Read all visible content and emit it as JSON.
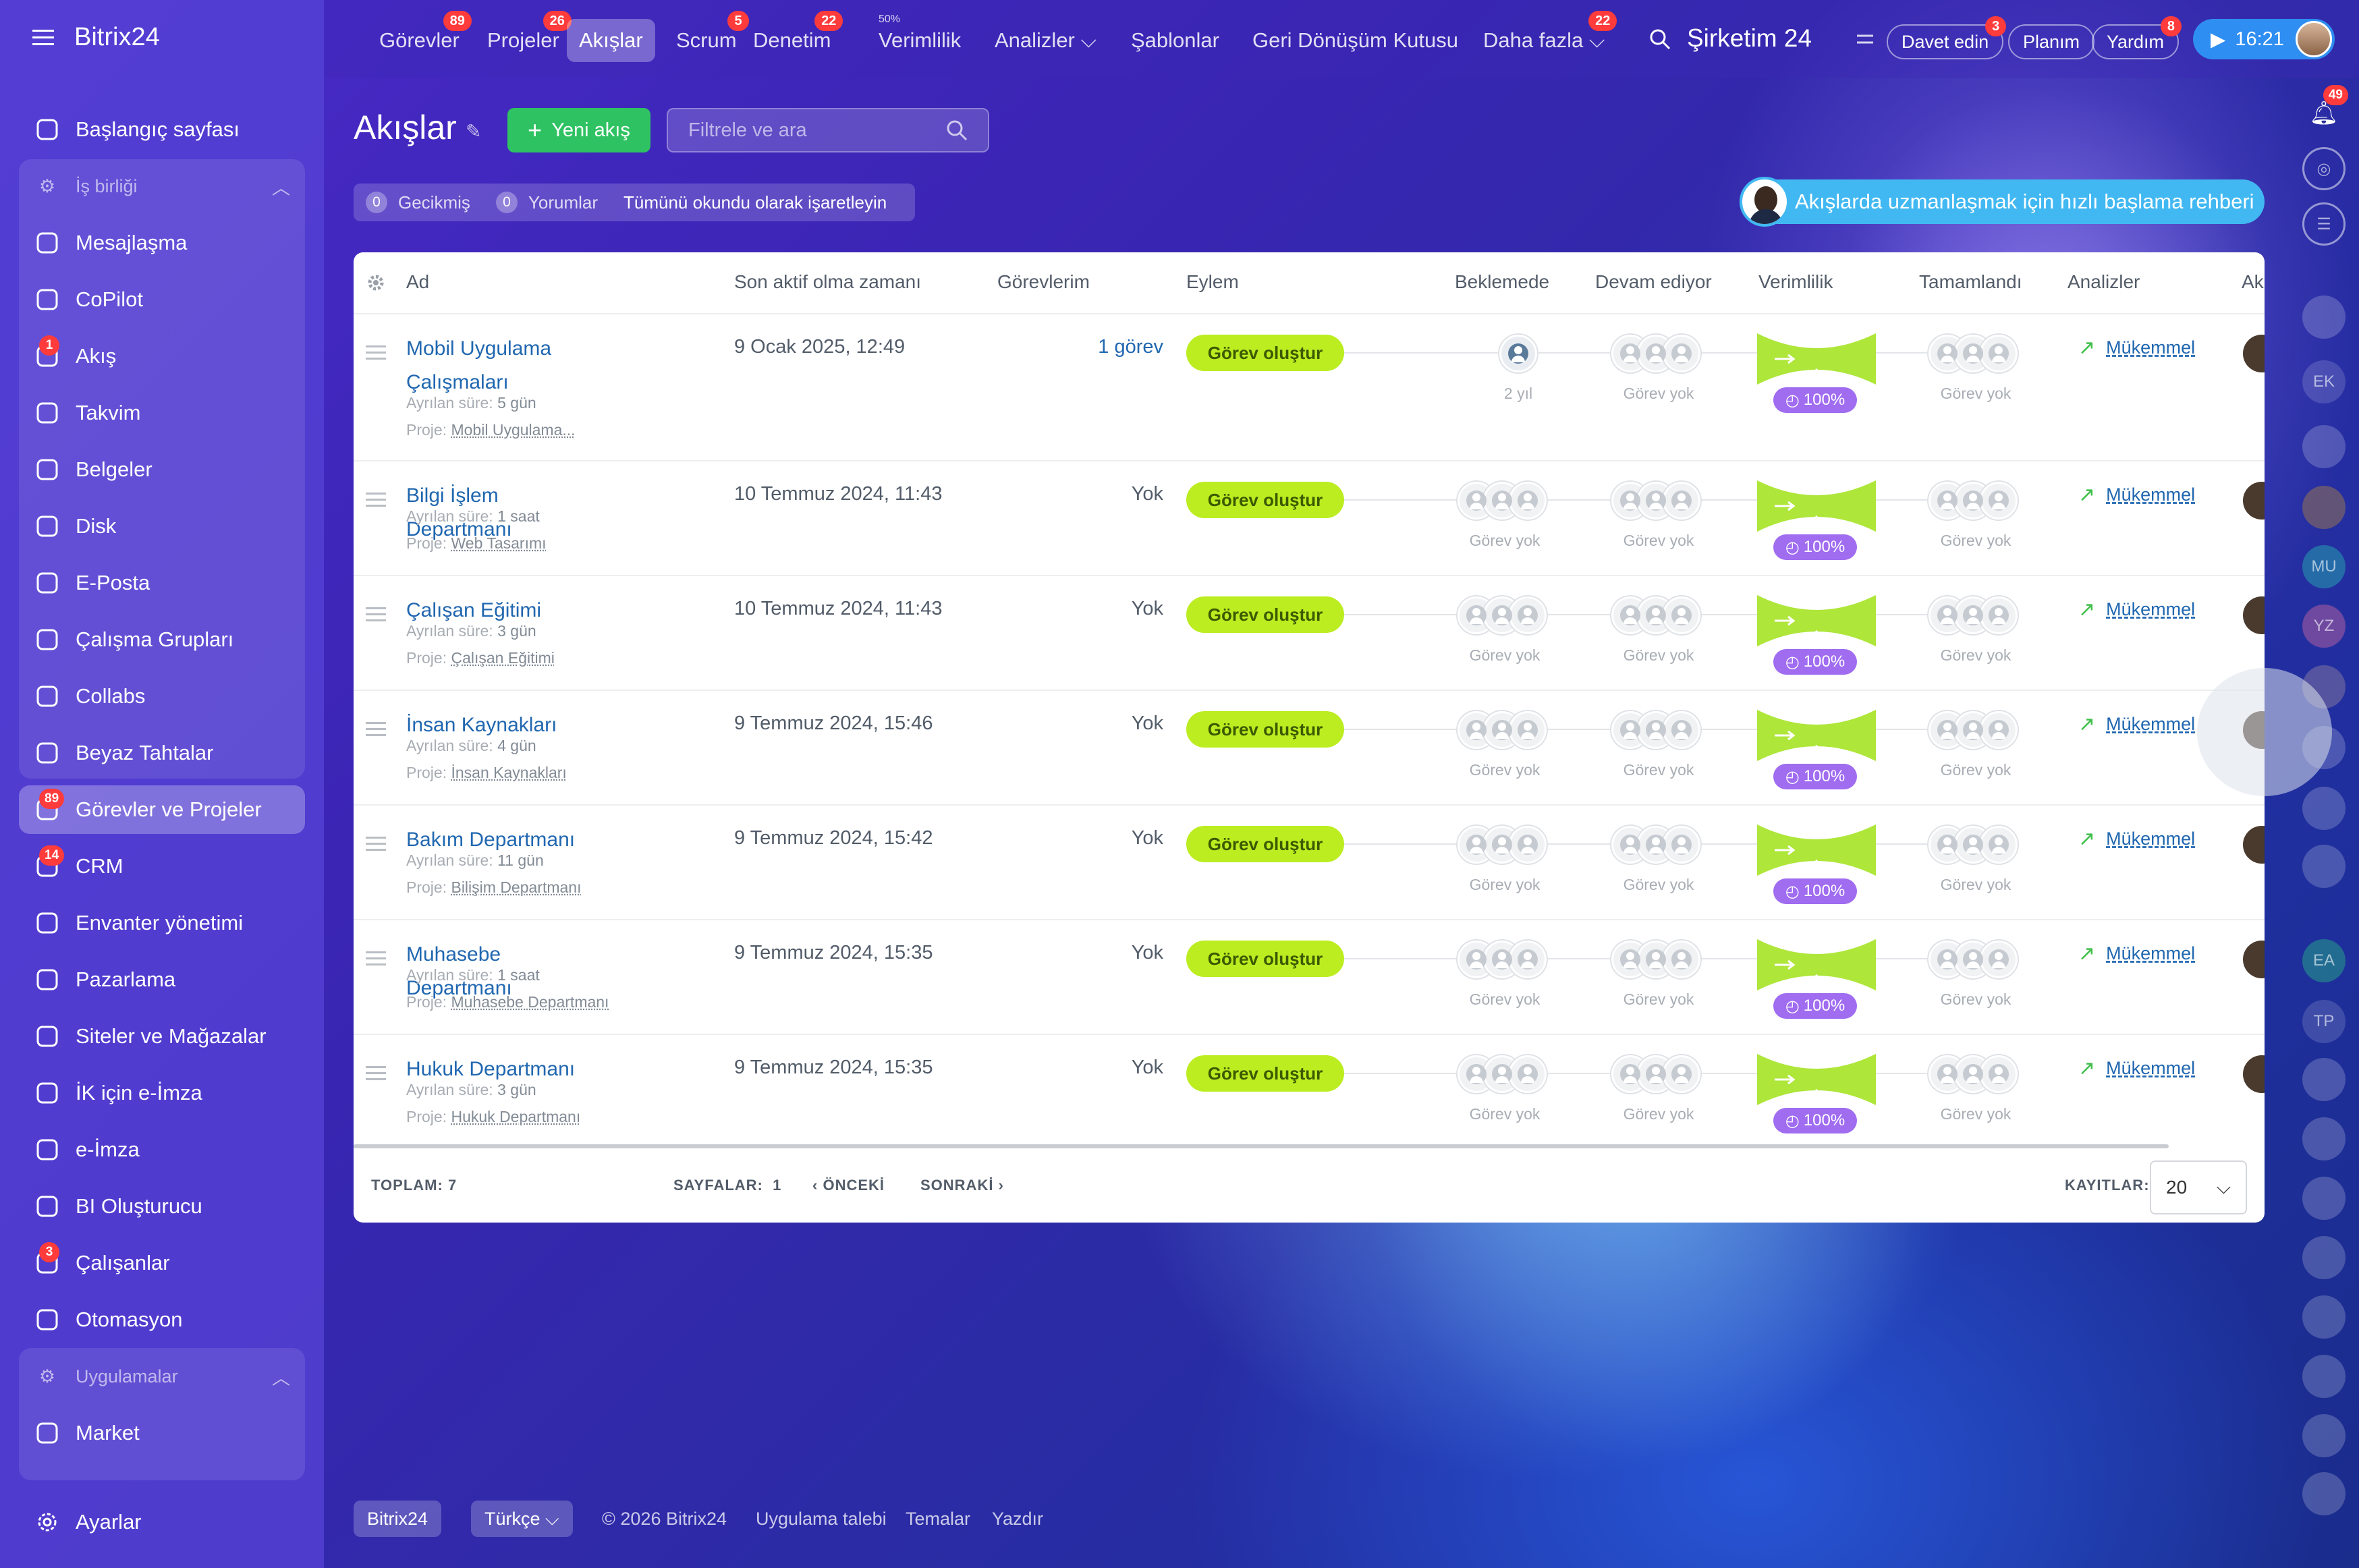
{
  "app": {
    "brand": "Bitrix24"
  },
  "sidebar": {
    "items": [
      {
        "label": "Başlangıç sayfası",
        "icon": "home-icon"
      },
      {
        "label": "Mesajlaşma",
        "icon": "chat-icon"
      },
      {
        "label": "CoPilot",
        "icon": "copilot-icon"
      },
      {
        "label": "Akış",
        "icon": "feed-icon",
        "badge": "1"
      },
      {
        "label": "Takvim",
        "icon": "calendar-icon"
      },
      {
        "label": "Belgeler",
        "icon": "document-icon"
      },
      {
        "label": "Disk",
        "icon": "disk-icon"
      },
      {
        "label": "E-Posta",
        "icon": "mail-icon"
      },
      {
        "label": "Çalışma Grupları",
        "icon": "group-icon"
      },
      {
        "label": "Collabs",
        "icon": "collabs-icon"
      },
      {
        "label": "Beyaz Tahtalar",
        "icon": "whiteboard-icon"
      },
      {
        "label": "Görevler ve Projeler",
        "icon": "tasks-icon",
        "badge": "89"
      },
      {
        "label": "CRM",
        "icon": "crm-icon",
        "badge": "14"
      },
      {
        "label": "Envanter yönetimi",
        "icon": "inventory-icon"
      },
      {
        "label": "Pazarlama",
        "icon": "marketing-icon"
      },
      {
        "label": "Siteler ve Mağazalar",
        "icon": "cart-icon"
      },
      {
        "label": "İK için e-İmza",
        "icon": "hr-sign-icon"
      },
      {
        "label": "e-İmza",
        "icon": "sign-icon"
      },
      {
        "label": "BI Oluşturucu",
        "icon": "bi-icon"
      },
      {
        "label": "Çalışanlar",
        "icon": "employees-icon",
        "badge": "3"
      },
      {
        "label": "Otomasyon",
        "icon": "automation-icon"
      },
      {
        "label": "Market",
        "icon": "market-icon"
      }
    ],
    "group1": "İş birliği",
    "group2": "Uygulamalar",
    "settings": "Ayarlar"
  },
  "topnav": {
    "items": [
      {
        "label": "Görevler",
        "badge": "89"
      },
      {
        "label": "Projeler",
        "badge": "26"
      },
      {
        "label": "Akışlar",
        "badge": ""
      },
      {
        "label": "Scrum",
        "badge": "5"
      },
      {
        "label": "Denetim",
        "badge": "22"
      },
      {
        "label": "Verimlilik",
        "badge": "",
        "sup": "50%"
      },
      {
        "label": "Analizler ⌵",
        "badge": ""
      },
      {
        "label": "Şablonlar",
        "badge": ""
      },
      {
        "label": "Geri Dönüşüm Kutusu",
        "badge": ""
      },
      {
        "label": "Daha fazla ⌵",
        "badge": "22"
      }
    ],
    "company": "Şirketim 24",
    "invite": "Davet edin",
    "invite_badge": "3",
    "plan": "Planım",
    "help": "Yardım",
    "help_badge": "8",
    "time": "16:21"
  },
  "page": {
    "title": "Akışlar",
    "new_button": "Yeni akış",
    "search_placeholder": "Filtrele ve ara",
    "counters": {
      "late_num": "0",
      "late": "Gecikmiş",
      "comments_num": "0",
      "comments": "Yorumlar",
      "mark_read": "Tümünü okundu olarak işaretleyin"
    },
    "guide": "Akışlarda uzmanlaşmak için hızlı başlama rehberi"
  },
  "grid": {
    "headers": {
      "name": "Ad",
      "last_active": "Son aktif olma zamanı",
      "my_tasks": "Görevlerim",
      "action": "Eylem",
      "pending": "Beklemede",
      "in_progress": "Devam ediyor",
      "efficiency": "Verimlilik",
      "done": "Tamamlandı",
      "analytics": "Analizler",
      "extra": "Ak"
    },
    "time_label": "Ayrılan süre:",
    "project_label": "Proje:",
    "action_label": "Görev oluştur",
    "no_task": "Görev yok",
    "analytics_label": "Mükemmel",
    "rows": [
      {
        "name": "Mobil Uygulama Çalışmaları",
        "time": "5 gün",
        "project": "Mobil Uygulama...",
        "date": "9 Ocak 2025, 12:49",
        "mytasks": "1 görev",
        "pending": "2 yıl",
        "efficiency": "100%"
      },
      {
        "name": "Bilgi İşlem Departmanı",
        "time": "1 saat",
        "project": "Web Tasarımı",
        "date": "10 Temmuz 2024, 11:43",
        "mytasks": "Yok",
        "pending": "Görev yok",
        "efficiency": "100%"
      },
      {
        "name": "Çalışan Eğitimi",
        "time": "3 gün",
        "project": "Çalışan Eğitimi",
        "date": "10 Temmuz 2024, 11:43",
        "mytasks": "Yok",
        "pending": "Görev yok",
        "efficiency": "100%"
      },
      {
        "name": "İnsan Kaynakları",
        "time": "4 gün",
        "project": "İnsan Kaynakları",
        "date": "9 Temmuz 2024, 15:46",
        "mytasks": "Yok",
        "pending": "Görev yok",
        "efficiency": "100%"
      },
      {
        "name": "Bakım Departmanı",
        "time": "11 gün",
        "project": "Bilişim Departmanı",
        "date": "9 Temmuz 2024, 15:42",
        "mytasks": "Yok",
        "pending": "Görev yok",
        "efficiency": "100%"
      },
      {
        "name": "Muhasebe Departmanı",
        "time": "1 saat",
        "project": "Muhasebe Departmanı",
        "date": "9 Temmuz 2024, 15:35",
        "mytasks": "Yok",
        "pending": "Görev yok",
        "efficiency": "100%"
      },
      {
        "name": "Hukuk Departmanı",
        "time": "3 gün",
        "project": "Hukuk Departmanı",
        "date": "9 Temmuz 2024, 15:35",
        "mytasks": "Yok",
        "pending": "Görev yok",
        "efficiency": "100%"
      }
    ],
    "footer": {
      "total_label": "TOPLAM:",
      "total": "7",
      "pages_label": "SAYFALAR:",
      "pages": "1",
      "prev": "ÖNCEKİ",
      "next": "SONRAKİ",
      "records_label": "KAYITLAR:",
      "records": "20"
    }
  },
  "rail": {
    "ek": "EK",
    "mu": "MU",
    "yz": "YZ",
    "ea": "EA",
    "tp": "TP",
    "bell_badge": "49"
  },
  "footer": {
    "brand": "Bitrix24",
    "lang": "Türkçe",
    "copyright": "© 2026 Bitrix24",
    "app_request": "Uygulama talebi",
    "themes": "Temalar",
    "print": "Yazdır"
  }
}
